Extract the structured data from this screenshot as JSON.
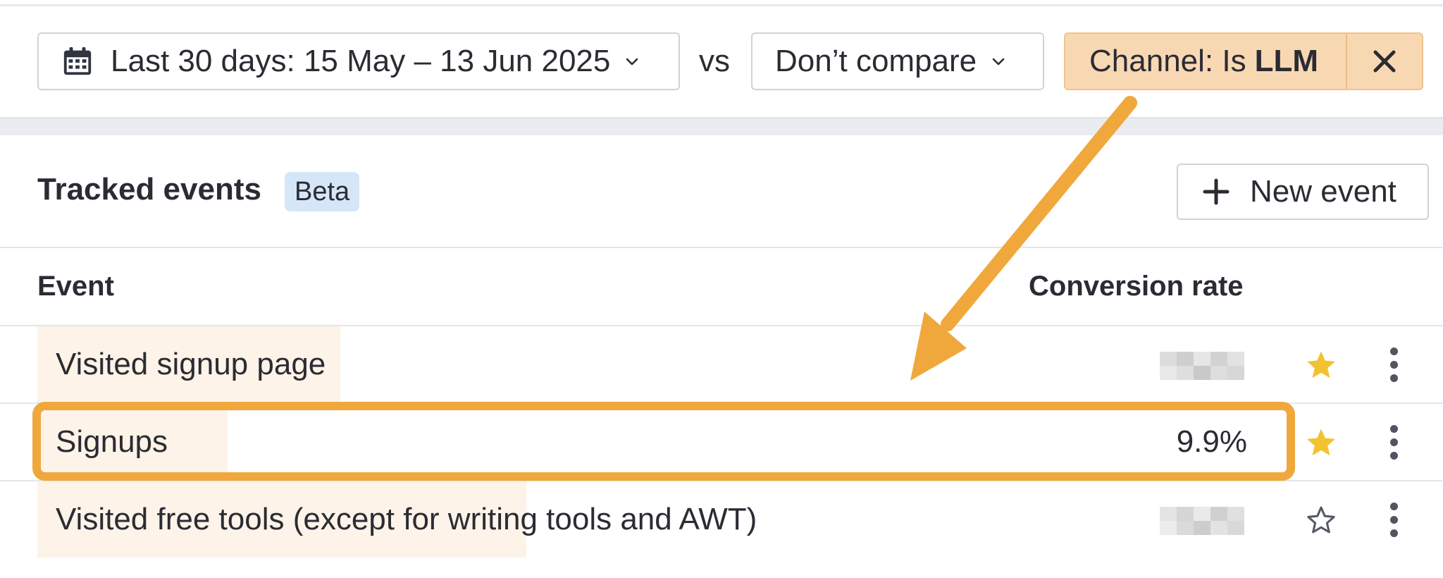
{
  "filters": {
    "date_range_label": "Last 30 days: 15 May – 13 Jun 2025",
    "vs_label": "vs",
    "compare_label": "Don’t compare",
    "channel_filter": {
      "prefix": "Channel: Is",
      "value": "LLM"
    }
  },
  "section": {
    "title": "Tracked events",
    "badge": "Beta",
    "new_event_label": "New event"
  },
  "table": {
    "columns": [
      "Event",
      "Conversion rate"
    ],
    "rows": [
      {
        "name": "Visited signup page",
        "conversion_rate": null,
        "rate_hidden": true,
        "starred": true
      },
      {
        "name": "Signups",
        "conversion_rate": "9.9%",
        "rate_hidden": false,
        "starred": true,
        "highlighted": true
      },
      {
        "name": "Visited free tools (except for writing tools and AWT)",
        "conversion_rate": null,
        "rate_hidden": true,
        "starred": false
      }
    ]
  },
  "colors": {
    "chip_bg": "#f8d8b3",
    "highlight": "#f0a83c",
    "star_filled": "#f2c230",
    "badge_bg": "#d6e6f9"
  }
}
